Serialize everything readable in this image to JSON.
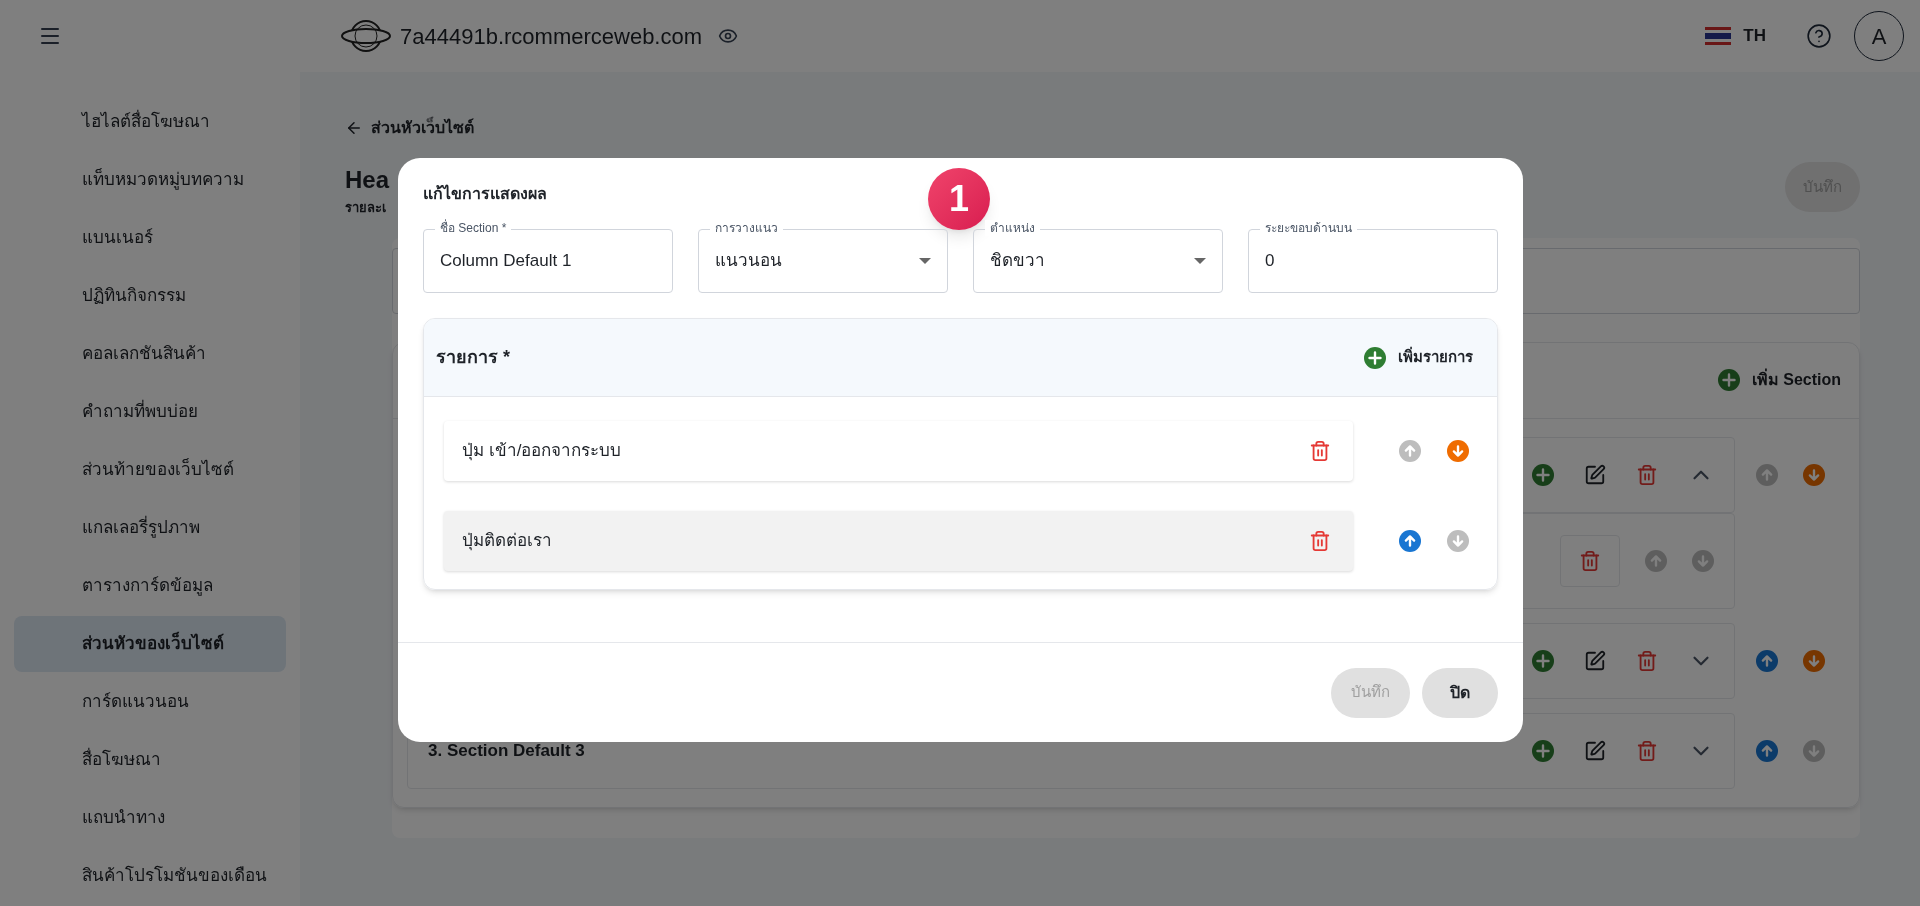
{
  "topbar": {
    "domain": "7a44491b.rcommerceweb.com",
    "language": "TH",
    "avatar": "A"
  },
  "sidebar": {
    "items": [
      {
        "label": "ไฮไลต์สื่อโฆษณา",
        "selected": false
      },
      {
        "label": "แท็บหมวดหมู่บทความ",
        "selected": false
      },
      {
        "label": "แบนเนอร์",
        "selected": false
      },
      {
        "label": "ปฏิทินกิจกรรม",
        "selected": false
      },
      {
        "label": "คอลเลกชันสินค้า",
        "selected": false
      },
      {
        "label": "คำถามที่พบบ่อย",
        "selected": false
      },
      {
        "label": "ส่วนท้ายของเว็บไซต์",
        "selected": false
      },
      {
        "label": "แกลเลอรี่รูปภาพ",
        "selected": false
      },
      {
        "label": "ตารางการ์ดข้อมูล",
        "selected": false
      },
      {
        "label": "ส่วนหัวของเว็บไซต์",
        "selected": true
      },
      {
        "label": "การ์ดแนวนอน",
        "selected": false
      },
      {
        "label": "สื่อโฆษณา",
        "selected": false
      },
      {
        "label": "แถบนำทาง",
        "selected": false
      },
      {
        "label": "สินค้าโปรโมชันของเดือน",
        "selected": false
      }
    ]
  },
  "page": {
    "back_link": "ส่วนหัวเว็บไซต์",
    "title": "Hea",
    "subtitle": "รายละเ",
    "save_button": {
      "label": "บันทึก",
      "disabled": true
    },
    "add_section_button": "เพิ่ม Section",
    "sections": [
      {
        "expanded": true,
        "can_move_up": false,
        "can_move_down": true,
        "children": [
          {
            "can_move_up": false,
            "can_move_down": false
          }
        ]
      },
      {
        "expanded": false,
        "can_move_up": true,
        "can_move_down": true
      },
      {
        "title": "3. Section Default 3",
        "expanded": false,
        "can_move_up": true,
        "can_move_down": false
      }
    ]
  },
  "dialog": {
    "title": "แก้ไขการแสดงผล",
    "callout": "1",
    "fields": [
      {
        "kind": "text",
        "label": "ชื่อ Section *",
        "value": "Column Default 1"
      },
      {
        "kind": "select",
        "label": "การวางแนว",
        "value": "แนวนอน"
      },
      {
        "kind": "select",
        "label": "ตำแหน่ง",
        "value": "ชิดขวา"
      },
      {
        "kind": "text",
        "label": "ระยะขอบด้านบน",
        "value": "0"
      }
    ],
    "items_panel": {
      "title": "รายการ *",
      "add_button": "เพิ่มรายการ",
      "items": [
        {
          "label": "ปุ่ม เข้า/ออกจากระบบ",
          "highlighted": false,
          "can_move_up": false,
          "can_move_down": true
        },
        {
          "label": "ปุ่มติดต่อเรา",
          "highlighted": true,
          "can_move_up": true,
          "can_move_down": false
        }
      ]
    },
    "save_button": {
      "label": "บันทึก",
      "disabled": true
    },
    "close_button": "ปิด"
  }
}
